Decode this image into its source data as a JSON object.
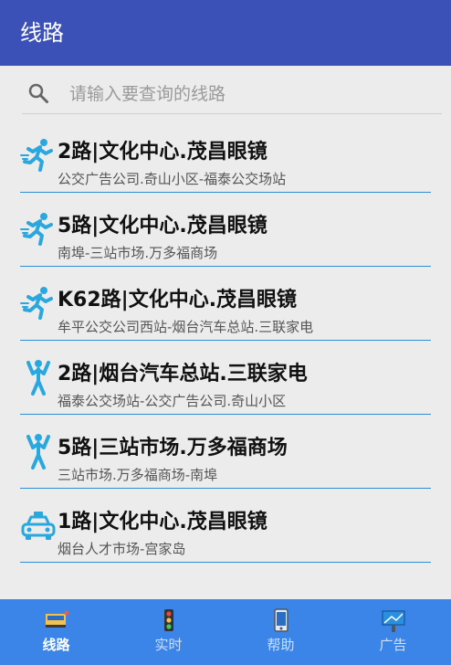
{
  "app": {
    "title": "线路"
  },
  "search": {
    "placeholder": "请输入要查询的线路"
  },
  "routes": [
    {
      "icon": "runner-icon",
      "title": "2路|文化中心.茂昌眼镜",
      "subtitle": "公交广告公司.奇山小区-福泰公交场站"
    },
    {
      "icon": "runner-icon",
      "title": "5路|文化中心.茂昌眼镜",
      "subtitle": "南埠-三站市场.万多福商场"
    },
    {
      "icon": "runner-icon",
      "title": "K62路|文化中心.茂昌眼镜",
      "subtitle": "牟平公交公司西站-烟台汽车总站.三联家电"
    },
    {
      "icon": "standing-person-icon",
      "title": "2路|烟台汽车总站.三联家电",
      "subtitle": "福泰公交场站-公交广告公司.奇山小区"
    },
    {
      "icon": "standing-person-icon",
      "title": "5路|三站市场.万多福商场",
      "subtitle": "三站市场.万多福商场-南埠"
    },
    {
      "icon": "taxi-icon",
      "title": "1路|文化中心.茂昌眼镜",
      "subtitle": "烟台人才市场-宫家岛"
    }
  ],
  "nav": {
    "tabs": [
      {
        "label": "线路",
        "icon": "bus-route-icon",
        "active": true
      },
      {
        "label": "实时",
        "icon": "traffic-light-icon",
        "active": false
      },
      {
        "label": "帮助",
        "icon": "phone-help-icon",
        "active": false
      },
      {
        "label": "广告",
        "icon": "billboard-icon",
        "active": false
      }
    ]
  },
  "colors": {
    "appbar": "#3c51b8",
    "bottomnav": "#3b84e8",
    "accent": "#29a8e0"
  }
}
